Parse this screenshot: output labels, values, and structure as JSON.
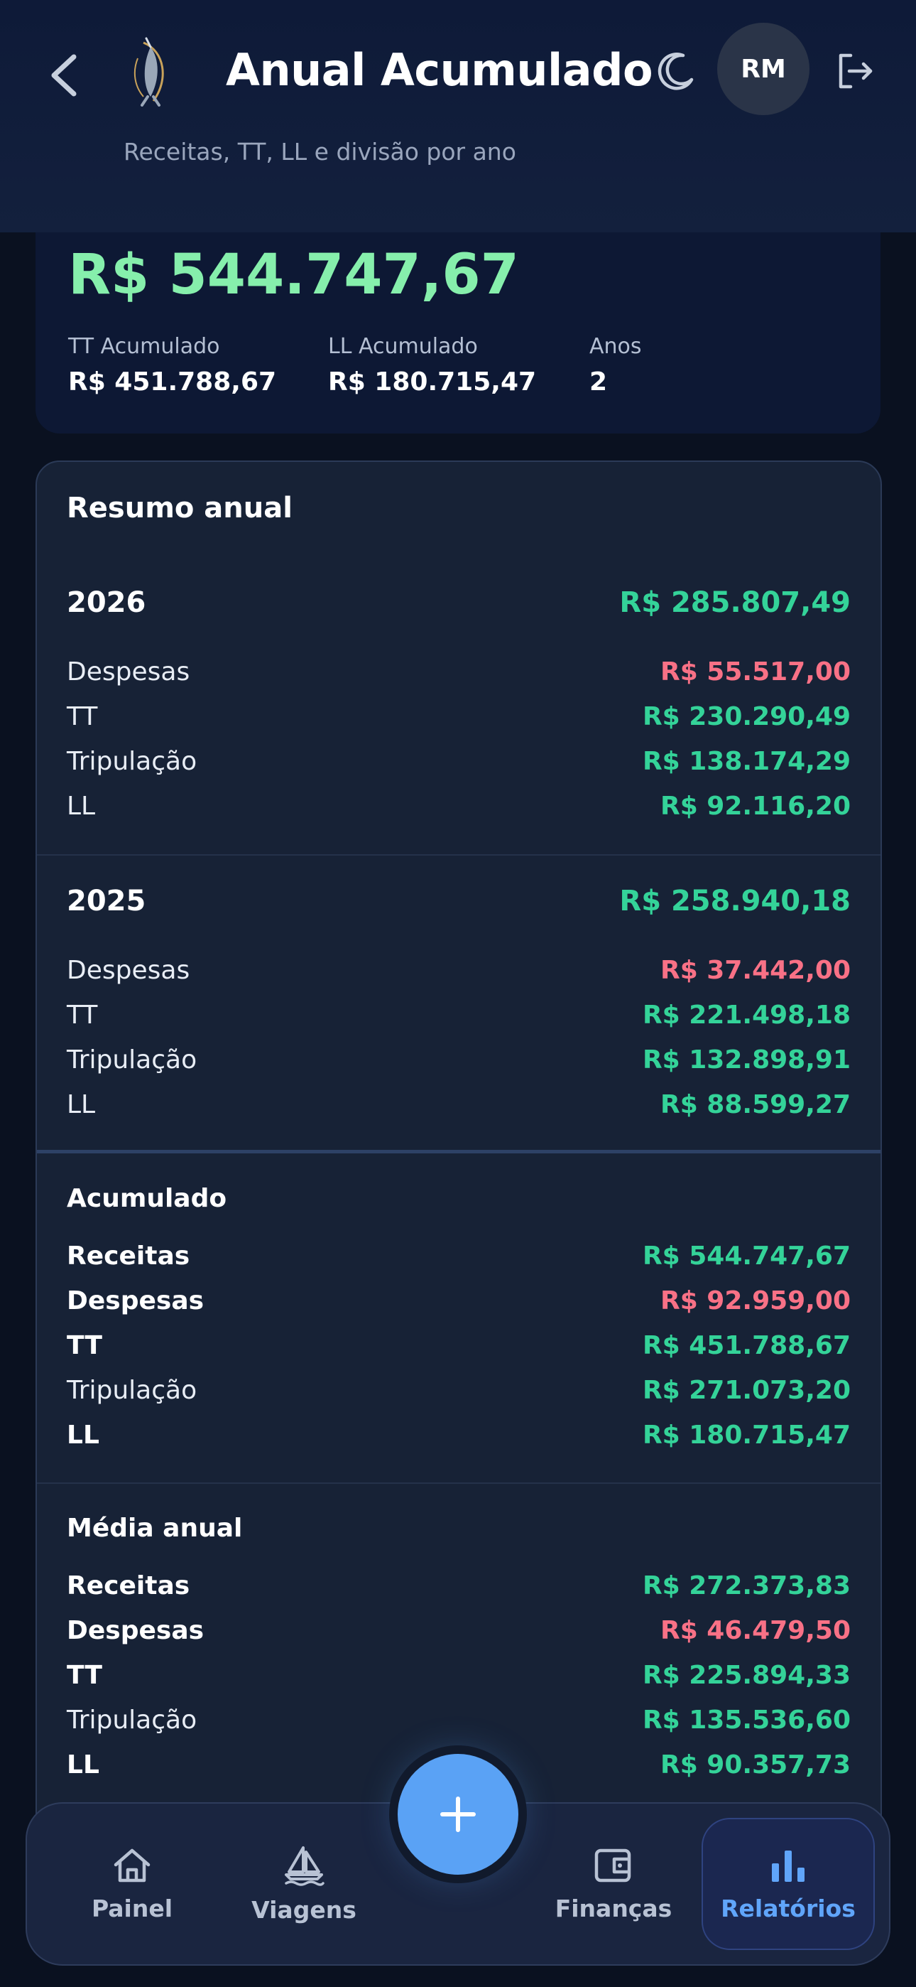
{
  "header": {
    "title": "Anual Acumulado",
    "subtitle": "Receitas, TT, LL e divisão por ano",
    "avatar_initials": "RM",
    "icons": {
      "back": "chevron-left-icon",
      "logo": "marlin-logo",
      "theme": "moon-icon",
      "logout": "logout-icon"
    }
  },
  "summary": {
    "total": "R$ 544.747,67",
    "stats": [
      {
        "label": "TT Acumulado",
        "value": "R$ 451.788,67"
      },
      {
        "label": "LL Acumulado",
        "value": "R$ 180.715,47"
      },
      {
        "label": "Anos",
        "value": "2"
      }
    ]
  },
  "annual": {
    "title": "Resumo anual",
    "years": [
      {
        "year": "2026",
        "total": "R$ 285.807,49",
        "rows": [
          {
            "label": "Despesas",
            "value": "R$ 55.517,00"
          },
          {
            "label": "TT",
            "value": "R$ 230.290,49"
          },
          {
            "label": "Tripulação",
            "value": "R$ 138.174,29"
          },
          {
            "label": "LL",
            "value": "R$ 92.116,20"
          }
        ]
      },
      {
        "year": "2025",
        "total": "R$ 258.940,18",
        "rows": [
          {
            "label": "Despesas",
            "value": "R$ 37.442,00"
          },
          {
            "label": "TT",
            "value": "R$ 221.498,18"
          },
          {
            "label": "Tripulação",
            "value": "R$ 132.898,91"
          },
          {
            "label": "LL",
            "value": "R$ 88.599,27"
          }
        ]
      }
    ],
    "accumulated": {
      "title": "Acumulado",
      "rows": [
        {
          "label": "Receitas",
          "value": "R$ 544.747,67"
        },
        {
          "label": "Despesas",
          "value": "R$ 92.959,00"
        },
        {
          "label": "TT",
          "value": "R$ 451.788,67"
        },
        {
          "label": "Tripulação",
          "value": "R$ 271.073,20"
        },
        {
          "label": "LL",
          "value": "R$ 180.715,47"
        }
      ]
    },
    "average": {
      "title": "Média anual",
      "rows": [
        {
          "label": "Receitas",
          "value": "R$ 272.373,83"
        },
        {
          "label": "Despesas",
          "value": "R$ 46.479,50"
        },
        {
          "label": "TT",
          "value": "R$ 225.894,33"
        },
        {
          "label": "Tripulação",
          "value": "R$ 135.536,60"
        },
        {
          "label": "LL",
          "value": "R$ 90.357,73"
        }
      ]
    }
  },
  "nav": {
    "items": [
      {
        "label": "Painel",
        "icon": "home-icon"
      },
      {
        "label": "Viagens",
        "icon": "sailboat-icon"
      },
      {
        "label": "Finanças",
        "icon": "wallet-icon"
      },
      {
        "label": "Relatórios",
        "icon": "bar-chart-icon"
      }
    ],
    "active": "Relatórios",
    "fab_icon": "plus-icon"
  },
  "colors": {
    "positive": "#34d399",
    "negative": "#f87186",
    "total_highlight": "#86efac",
    "accent": "#60a5fa"
  }
}
